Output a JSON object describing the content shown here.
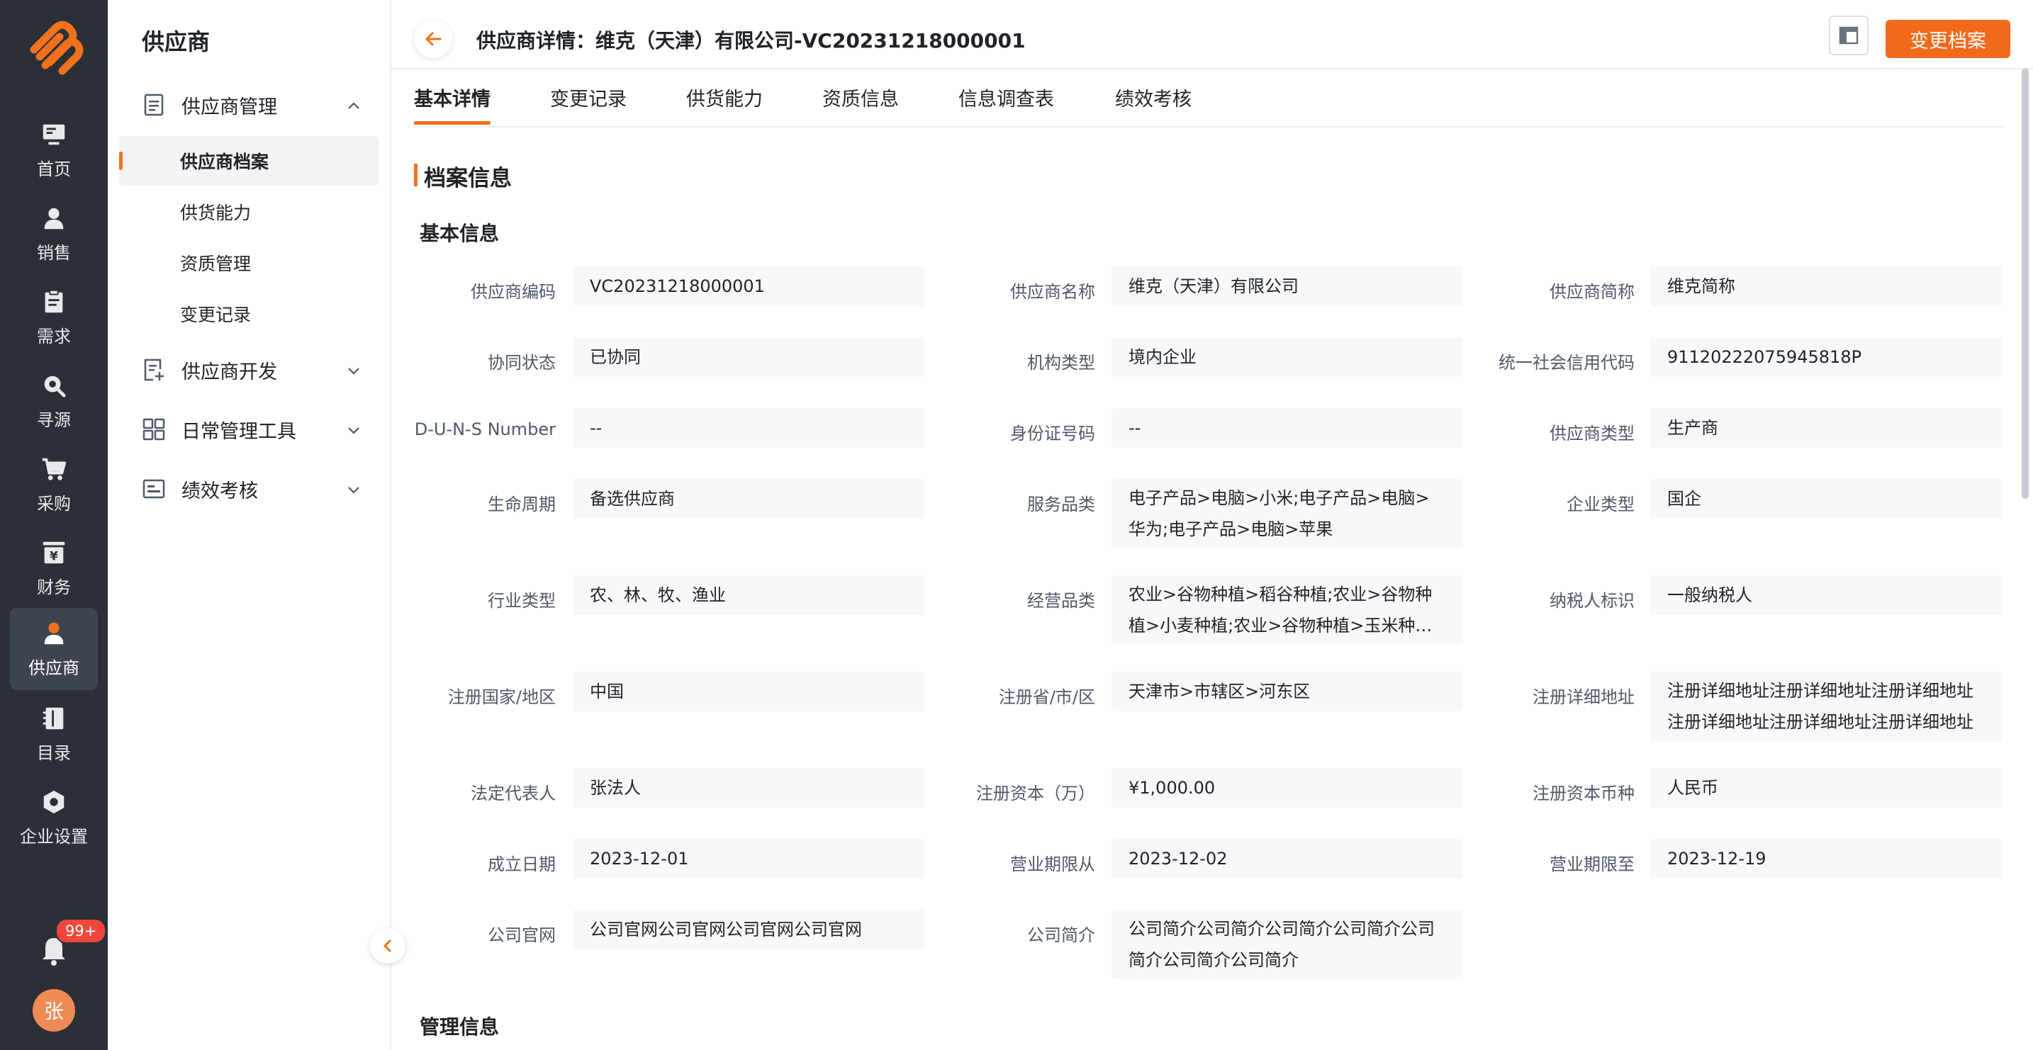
{
  "rail": {
    "items": [
      {
        "label": "首页",
        "icon": "monitor-icon"
      },
      {
        "label": "销售",
        "icon": "user-icon"
      },
      {
        "label": "需求",
        "icon": "clipboard-icon"
      },
      {
        "label": "寻源",
        "icon": "search-icon"
      },
      {
        "label": "采购",
        "icon": "cart-icon"
      },
      {
        "label": "财务",
        "icon": "yen-icon"
      },
      {
        "label": "供应商",
        "icon": "supplier-icon"
      },
      {
        "label": "目录",
        "icon": "catalog-icon"
      },
      {
        "label": "企业设置",
        "icon": "settings-icon"
      }
    ],
    "notification_count": "99+",
    "avatar_text": "张",
    "accent": "#f2711c"
  },
  "submenu": {
    "title": "供应商",
    "groups": [
      {
        "label": "供应商管理",
        "icon": "document-icon"
      },
      {
        "label": "供应商开发",
        "icon": "document-add-icon"
      },
      {
        "label": "日常管理工具",
        "icon": "grid-icon"
      },
      {
        "label": "绩效考核",
        "icon": "chart-card-icon"
      }
    ],
    "items": [
      "供应商档案",
      "供货能力",
      "资质管理",
      "变更记录"
    ]
  },
  "header": {
    "title": "供应商详情：维克（天津）有限公司-VC20231218000001",
    "action_label": "变更档案"
  },
  "tabs": [
    "基本详情",
    "变更记录",
    "供货能力",
    "资质信息",
    "信息调查表",
    "绩效考核"
  ],
  "section_title": "档案信息",
  "basic_info_title": "基本信息",
  "management_info_title": "管理信息",
  "fields": [
    {
      "label": "供应商编码",
      "value": "VC20231218000001"
    },
    {
      "label": "供应商名称",
      "value": "维克（天津）有限公司"
    },
    {
      "label": "供应商简称",
      "value": "维克简称"
    },
    {
      "label": "协同状态",
      "value": "已协同"
    },
    {
      "label": "机构类型",
      "value": "境内企业"
    },
    {
      "label": "统一社会信用代码",
      "value": "91120222075945818P"
    },
    {
      "label": "D-U-N-S Number",
      "value": "--"
    },
    {
      "label": "身份证号码",
      "value": "--"
    },
    {
      "label": "供应商类型",
      "value": "生产商"
    },
    {
      "label": "生命周期",
      "value": "备选供应商"
    },
    {
      "label": "服务品类",
      "value": "电子产品>电脑>小米;电子产品>电脑>华为;电子产品>电脑>苹果"
    },
    {
      "label": "企业类型",
      "value": "国企"
    },
    {
      "label": "行业类型",
      "value": "农、林、牧、渔业"
    },
    {
      "label": "经营品类",
      "value": "农业>谷物种植>稻谷种植;农业>谷物种植>小麦种植;农业>谷物种植>玉米种植;农..."
    },
    {
      "label": "纳税人标识",
      "value": "一般纳税人"
    },
    {
      "label": "注册国家/地区",
      "value": "中国"
    },
    {
      "label": "注册省/市/区",
      "value": "天津市>市辖区>河东区"
    },
    {
      "label": "注册详细地址",
      "value": "注册详细地址注册详细地址注册详细地址注册详细地址注册详细地址注册详细地址"
    },
    {
      "label": "法定代表人",
      "value": "张法人"
    },
    {
      "label": "注册资本（万）",
      "value": "¥1,000.00"
    },
    {
      "label": "注册资本币种",
      "value": "人民币"
    },
    {
      "label": "成立日期",
      "value": "2023-12-01"
    },
    {
      "label": "营业期限从",
      "value": "2023-12-02"
    },
    {
      "label": "营业期限至",
      "value": "2023-12-19"
    },
    {
      "label": "公司官网",
      "value": "公司官网公司官网公司官网公司官网"
    },
    {
      "label": "公司简介",
      "value": "公司简介公司简介公司简介公司简介公司简介公司简介公司简介"
    }
  ]
}
